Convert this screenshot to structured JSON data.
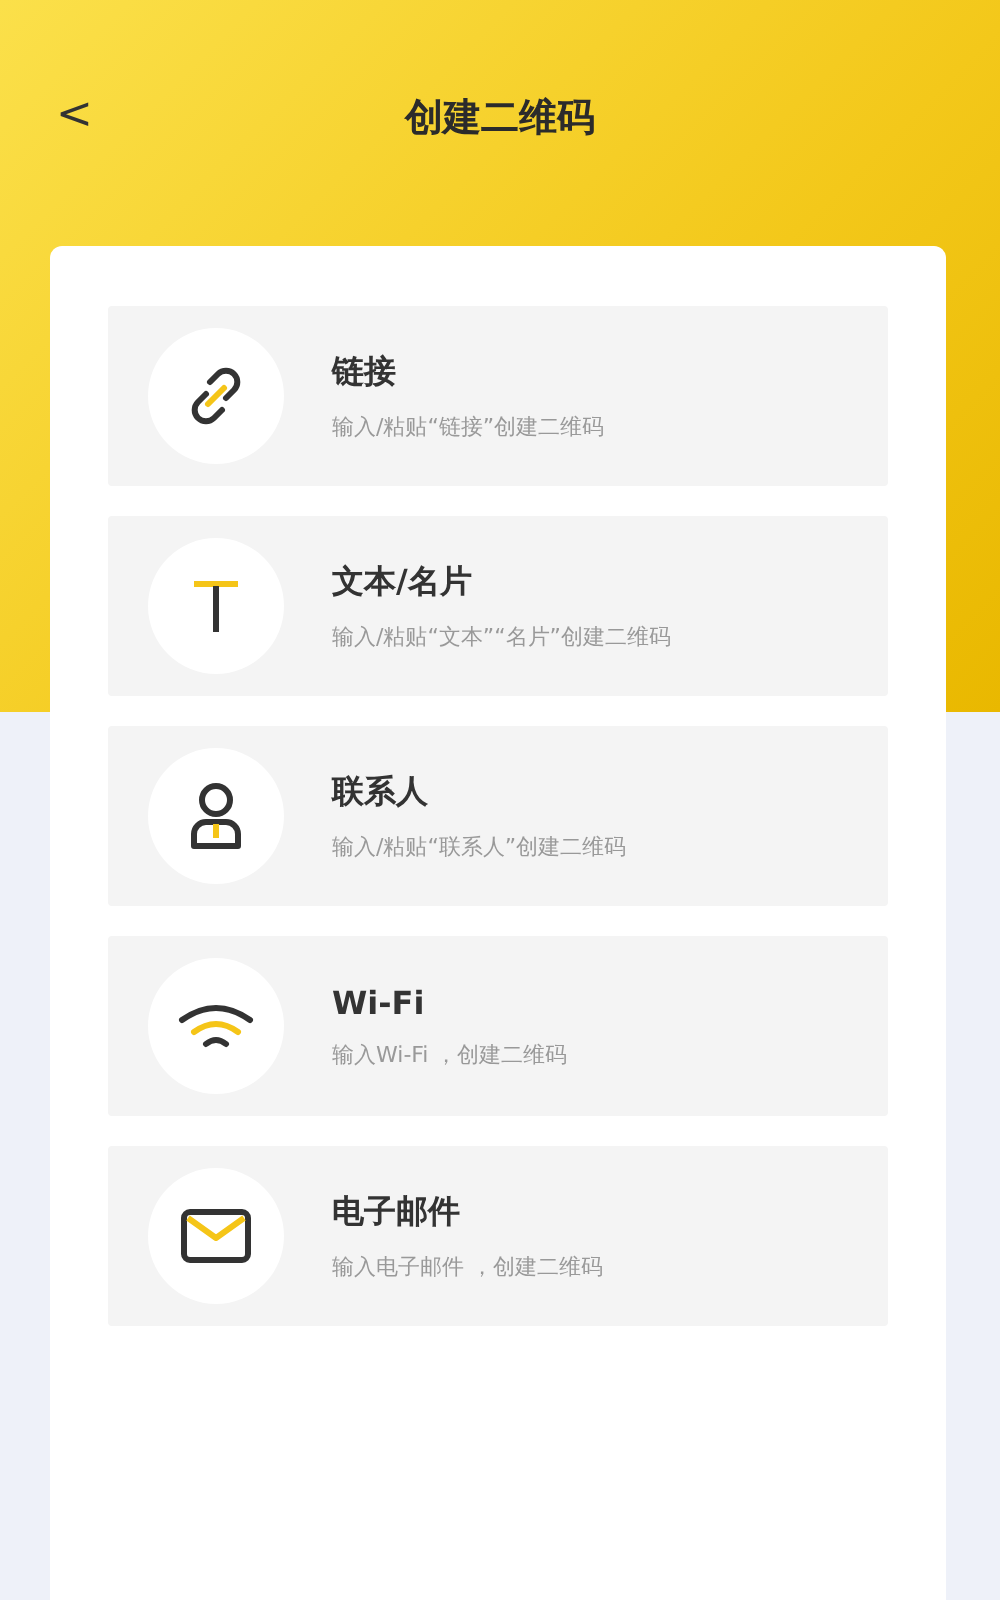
{
  "header": {
    "back": "<",
    "title": "创建二维码"
  },
  "items": [
    {
      "kind": "link",
      "title": "链接",
      "subtitle": "输入/粘贴“链接”创建二维码"
    },
    {
      "kind": "text",
      "title": "文本/名片",
      "subtitle": "输入/粘贴“文本”“名片”创建二维码"
    },
    {
      "kind": "contact",
      "title": "联系人",
      "subtitle": "输入/粘贴“联系人”创建二维码"
    },
    {
      "kind": "wifi",
      "title": "Wi-Fi",
      "subtitle": "输入Wi-Fi ，创建二维码"
    },
    {
      "kind": "email",
      "title": "电子邮件",
      "subtitle": "输入电子邮件 ，创建二维码"
    }
  ]
}
